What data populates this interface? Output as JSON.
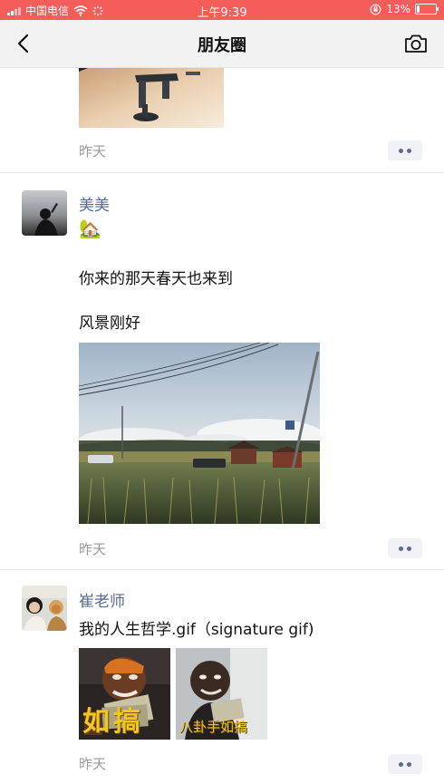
{
  "status_bar": {
    "carrier": "中国电信",
    "time": "上午9:39",
    "battery_percent": "13%",
    "battery_level": 0.13,
    "icons": [
      "signal-icon",
      "wifi-icon",
      "orientation-lock-icon",
      "battery-icon"
    ]
  },
  "nav": {
    "title": "朋友圈",
    "back_icon": "chevron-left-icon",
    "camera_icon": "camera-icon"
  },
  "posts": [
    {
      "time": "昨天",
      "image": "drone-photo"
    },
    {
      "author": "美美",
      "emoji": "🏡",
      "lines": [
        "你来的那天春天也来到",
        "风景刚好"
      ],
      "image": "countryside-field-photo",
      "time": "昨天"
    },
    {
      "author": "崔老师",
      "text": "我的人生哲学.gif（signature gif)",
      "gif_captions": [
        "如搞",
        "八卦手如搞"
      ],
      "time": "昨天"
    }
  ],
  "colors": {
    "status_bar": "#f45d5a",
    "author_link": "#576b95",
    "timestamp": "#9a9a9a",
    "nav_bg": "#f2f2f2"
  }
}
